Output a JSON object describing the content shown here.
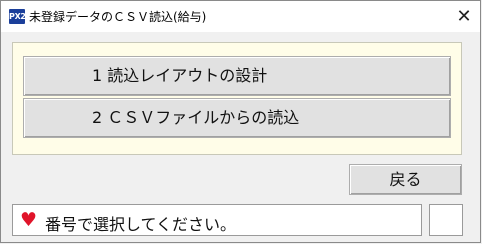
{
  "window": {
    "icon_text": "PX2",
    "title": "未登録データのＣＳＶ読込(給与)",
    "close_glyph": "✕"
  },
  "menu": {
    "items": [
      {
        "label": "1  読込レイアウトの設計"
      },
      {
        "label": "2  ＣＳＶファイルからの読込"
      }
    ]
  },
  "back_button": {
    "label": "戻る"
  },
  "status": {
    "icon": "heart-icon",
    "icon_glyph": "♥",
    "message": "番号で選択してください。",
    "input_value": ""
  },
  "colors": {
    "panel_background": "#fffde8",
    "heart": "#e0142a",
    "app_icon": "#1b3f9a"
  }
}
